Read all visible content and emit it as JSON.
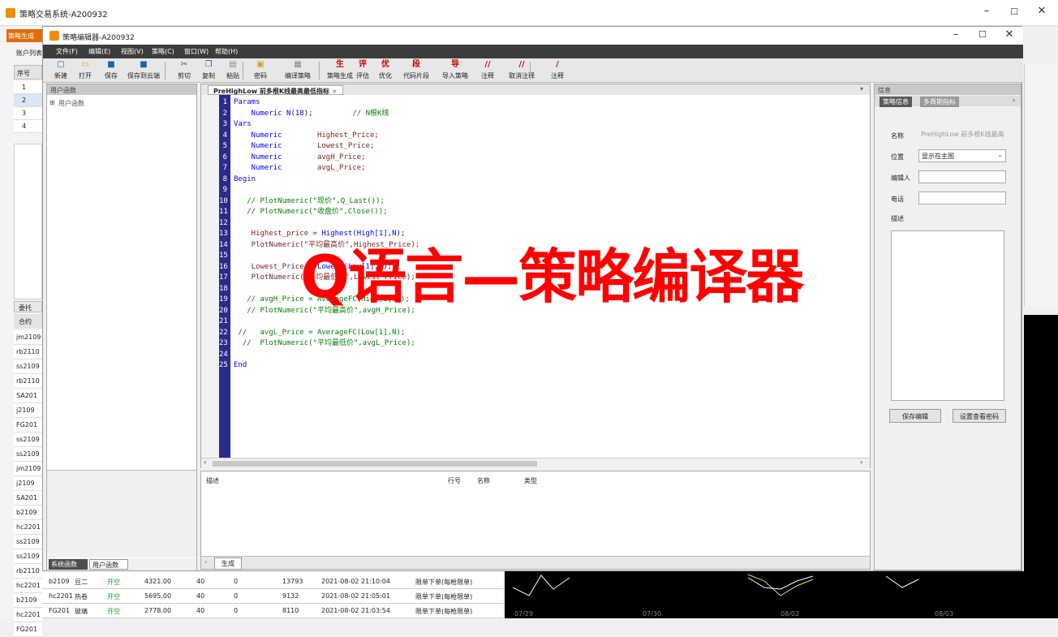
{
  "outer_window": {
    "title": "策略交易系统-A200932"
  },
  "outer_left": {
    "tab_label": "策略生成",
    "account_tab": "账户列表",
    "col_header": "序号",
    "rows": [
      "1",
      "2",
      "3",
      "4"
    ],
    "bottom_tab": "委托",
    "contract_header": "合约",
    "contracts": [
      "jm2109",
      "rb2110",
      "ss2109",
      "rb2110",
      "SA201",
      "j2109",
      "FG201",
      "ss2109",
      "ss2109",
      "jm2109",
      "j2109",
      "SA201",
      "b2109",
      "hc2201",
      "ss2109",
      "ss2109",
      "rb2110",
      "hc2201",
      "b2109",
      "hc2201",
      "FG201"
    ]
  },
  "orders": [
    {
      "code": "b2109",
      "name": "豆二",
      "action": "开空",
      "price": "4321.00",
      "qty": "40",
      "filled": "0",
      "num": "13793",
      "time": "2021-08-02 21:10:04",
      "type": "限单下单(每枪限单)"
    },
    {
      "code": "hc2201",
      "name": "热卷",
      "action": "开空",
      "price": "5695.00",
      "qty": "40",
      "filled": "0",
      "num": "9132",
      "time": "2021-08-02 21:05:01",
      "type": "限单下单(每枪限单)"
    },
    {
      "code": "FG201",
      "name": "玻璃",
      "action": "开空",
      "price": "2778.00",
      "qty": "40",
      "filled": "0",
      "num": "8110",
      "time": "2021-08-02 21:03:54",
      "type": "限单下单(每枪限单)"
    }
  ],
  "chart_dates": [
    "07/29",
    "07/30",
    "08/02",
    "08/03"
  ],
  "editor_window": {
    "title": "策略编辑器-A200932"
  },
  "menu": [
    "文件(F)",
    "编辑(E)",
    "视图(V)",
    "策略(C)",
    "窗口(W)",
    "帮助(H)"
  ],
  "toolbar": [
    {
      "label": "新建",
      "icon": "new-file-icon",
      "color": "#1e5fa8",
      "glyph": "▢"
    },
    {
      "label": "打开",
      "icon": "open-folder-icon",
      "color": "#d4a017",
      "glyph": "▭"
    },
    {
      "label": "保存",
      "icon": "save-icon",
      "color": "#1e5fa8",
      "glyph": "■"
    },
    {
      "label": "保存到云端",
      "icon": "cloud-save-icon",
      "color": "#1e5fa8",
      "glyph": "■"
    },
    {
      "label": "剪切",
      "icon": "cut-icon",
      "color": "#555555",
      "glyph": "✂"
    },
    {
      "label": "复制",
      "icon": "copy-icon",
      "color": "#1e5fa8",
      "glyph": "❐"
    },
    {
      "label": "粘贴",
      "icon": "paste-icon",
      "color": "#888888",
      "glyph": "▤"
    },
    {
      "label": "密码",
      "icon": "lock-icon",
      "color": "#d4a017",
      "glyph": "▣"
    },
    {
      "label": "编译策略",
      "icon": "compile-icon",
      "color": "#888888",
      "glyph": "▦"
    },
    {
      "label": "策略生成",
      "icon": "generate-icon",
      "color": "#d40000",
      "glyph": "生"
    },
    {
      "label": "评估",
      "icon": "evaluate-icon",
      "color": "#d40000",
      "glyph": "评"
    },
    {
      "label": "优化",
      "icon": "optimize-icon",
      "color": "#d40000",
      "glyph": "优"
    },
    {
      "label": "代码片段",
      "icon": "snippet-icon",
      "color": "#d40000",
      "glyph": "段"
    },
    {
      "label": "导入策略",
      "icon": "import-icon",
      "color": "#d40000",
      "glyph": "导"
    },
    {
      "label": "注释",
      "icon": "comment-icon",
      "color": "#d40000",
      "glyph": "//"
    },
    {
      "label": "取消注释",
      "icon": "uncomment-icon",
      "color": "#d40000",
      "glyph": "//"
    },
    {
      "label": "注释",
      "icon": "comment2-icon",
      "color": "#d40000",
      "glyph": "/"
    }
  ],
  "left_panel": {
    "header": "用户函数",
    "tree_item": "用户函数",
    "bottom_tabs": [
      "系统函数",
      "用户函数"
    ]
  },
  "editor": {
    "tab_title": "PreHighLow 前多根K线最高最低指标",
    "lines": [
      {
        "n": "1",
        "segs": [
          [
            "kw",
            "Params"
          ]
        ]
      },
      {
        "n": "2",
        "segs": [
          [
            "kw",
            "    Numeric N(18);"
          ],
          [
            "cm",
            "         // N根K线"
          ]
        ]
      },
      {
        "n": "3",
        "segs": [
          [
            "kw",
            "Vars"
          ]
        ]
      },
      {
        "n": "4",
        "segs": [
          [
            "kw",
            "    Numeric"
          ],
          [
            "tx",
            "        Highest_Price;"
          ]
        ]
      },
      {
        "n": "5",
        "segs": [
          [
            "kw",
            "    Numeric"
          ],
          [
            "tx",
            "        Lowest_Price;"
          ]
        ]
      },
      {
        "n": "6",
        "segs": [
          [
            "kw",
            "    Numeric"
          ],
          [
            "tx",
            "        avgH_Price;"
          ]
        ]
      },
      {
        "n": "7",
        "segs": [
          [
            "kw",
            "    Numeric"
          ],
          [
            "tx",
            "        avgL_Price;"
          ]
        ]
      },
      {
        "n": "8",
        "segs": [
          [
            "kw",
            "Begin"
          ]
        ]
      },
      {
        "n": "9",
        "segs": []
      },
      {
        "n": "10",
        "segs": [
          [
            "cm",
            "   // PlotNumeric(\"现价\",Q_Last());"
          ]
        ]
      },
      {
        "n": "11",
        "segs": [
          [
            "cm",
            "   // PlotNumeric(\"收盘价\",Close());"
          ]
        ]
      },
      {
        "n": "12",
        "segs": []
      },
      {
        "n": "13",
        "segs": [
          [
            "tx",
            "    Highest_price = "
          ],
          [
            "kw",
            "Highest(High[1],N);"
          ]
        ]
      },
      {
        "n": "14",
        "segs": [
          [
            "tx",
            "    PlotNumeric(\"平均最高价\",Highest_Price);"
          ]
        ]
      },
      {
        "n": "15",
        "segs": []
      },
      {
        "n": "16",
        "segs": [
          [
            "tx",
            "    Lowest_Price = "
          ],
          [
            "kw",
            "Lowest(Low[1],N);"
          ]
        ]
      },
      {
        "n": "17",
        "segs": [
          [
            "tx",
            "    PlotNumeric(\"平均最低价\",Lowest_Price);"
          ]
        ]
      },
      {
        "n": "18",
        "segs": []
      },
      {
        "n": "19",
        "segs": [
          [
            "cm",
            "   // avgH_Price = AverageFC(High[1],N);"
          ]
        ]
      },
      {
        "n": "20",
        "segs": [
          [
            "cm",
            "   // PlotNumeric(\"平均最高价\",avgH_Price);"
          ]
        ]
      },
      {
        "n": "21",
        "segs": []
      },
      {
        "n": "22",
        "segs": [
          [
            "cm",
            " //   avgL_Price = AverageFC(Low[1],N);"
          ]
        ]
      },
      {
        "n": "23",
        "segs": [
          [
            "cm",
            "  //  PlotNumeric(\"平均最低价\",avgL_Price);"
          ]
        ]
      },
      {
        "n": "24",
        "segs": []
      },
      {
        "n": "25",
        "segs": [
          [
            "kw",
            "End"
          ]
        ]
      }
    ]
  },
  "output": {
    "headers": [
      "描述",
      "行号",
      "名称",
      "类型"
    ],
    "tab": "生成"
  },
  "info_panel": {
    "header": "信息",
    "tabs": [
      "策略信息",
      "多周期指标"
    ],
    "name_label": "名称",
    "name_value": "PreHighLow 前多根K线最高",
    "position_label": "位置",
    "position_value": "显示在主图",
    "author_label": "编辑人",
    "phone_label": "电话",
    "desc_label": "描述",
    "save_btn": "保存编辑",
    "pwd_btn": "设置查看密码"
  },
  "overlay_text": "Q语言—策略编译器"
}
